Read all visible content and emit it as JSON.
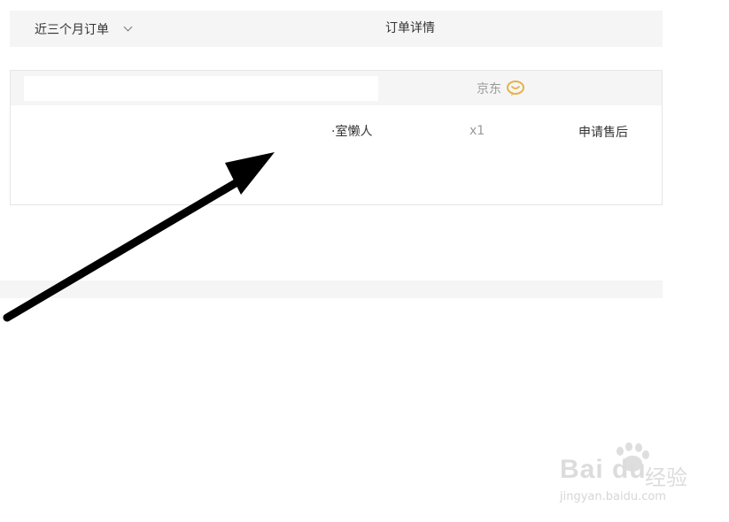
{
  "header": {
    "filter_label": "近三个月订单",
    "title": "订单详情"
  },
  "order": {
    "shop_name": "京东",
    "product_name": "·室懒人",
    "quantity": "x1",
    "after_sale_label": "申请售后"
  },
  "watermark": {
    "brand": "Bai du",
    "brand_cn": "经验",
    "url": "jingyan.baidu.com"
  },
  "colors": {
    "bar_bg": "#f5f5f5",
    "chat_icon": "#e6b24a",
    "arrow": "#000000"
  },
  "icons": {
    "dropdown": "chevron-down-icon",
    "chat": "chat-bubble-icon",
    "annotation": "arrow-icon",
    "paw": "baidu-paw-icon"
  }
}
